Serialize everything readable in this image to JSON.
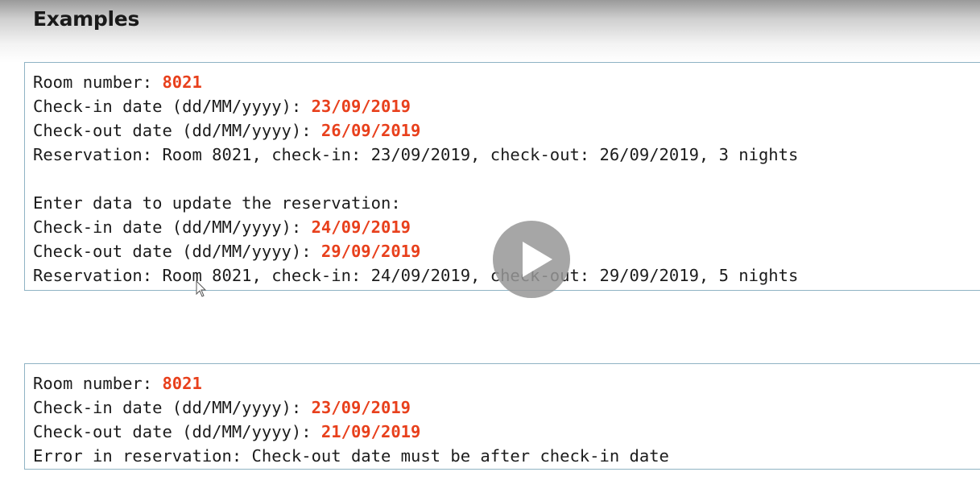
{
  "heading": "Examples",
  "example1": {
    "room_label": "Room number: ",
    "room_value": "8021",
    "checkin_label": "Check-in date (dd/MM/yyyy): ",
    "checkin_value": "23/09/2019",
    "checkout_label": "Check-out date (dd/MM/yyyy): ",
    "checkout_value": "26/09/2019",
    "reservation_line": "Reservation: Room 8021, check-in: 23/09/2019, check-out: 26/09/2019, 3 nights",
    "update_prompt": "Enter data to update the reservation:",
    "checkin2_label": "Check-in date (dd/MM/yyyy): ",
    "checkin2_value": "24/09/2019",
    "checkout2_label": "Check-out date (dd/MM/yyyy): ",
    "checkout2_value": "29/09/2019",
    "reservation_line2": "Reservation: Room 8021, check-in: 24/09/2019, check-out: 29/09/2019, 5 nights"
  },
  "example2": {
    "room_label": "Room number: ",
    "room_value": "8021",
    "checkin_label": "Check-in date (dd/MM/yyyy): ",
    "checkin_value": "23/09/2019",
    "checkout_label": "Check-out date (dd/MM/yyyy): ",
    "checkout_value": "21/09/2019",
    "error_line": "Error in reservation: Check-out date must be after check-in date"
  },
  "colors": {
    "input": "#e8401c",
    "output": "#1c1c1c",
    "border": "#8fb3c4"
  },
  "icons": {
    "play": "play-icon",
    "cursor": "mouse-pointer-icon"
  }
}
